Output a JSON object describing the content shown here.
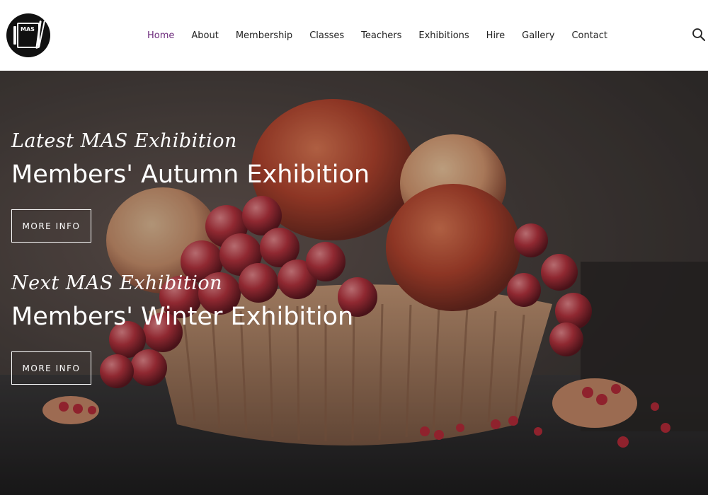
{
  "header": {
    "logo_text": "MAS",
    "nav": [
      {
        "label": "Home",
        "active": true
      },
      {
        "label": "About"
      },
      {
        "label": "Membership"
      },
      {
        "label": "Classes"
      },
      {
        "label": "Teachers"
      },
      {
        "label": "Exhibitions"
      },
      {
        "label": "Hire"
      },
      {
        "label": "Gallery"
      },
      {
        "label": "Contact"
      }
    ],
    "search_icon": "search-icon"
  },
  "hero": {
    "latest": {
      "subtitle": "Latest MAS Exhibition",
      "title": "Members' Autumn Exhibition",
      "button": "MORE INFO"
    },
    "next": {
      "subtitle": "Next MAS Exhibition",
      "title": "Members' Winter Exhibition",
      "button": "MORE INFO"
    }
  },
  "colors": {
    "nav_active": "#6d2b7c",
    "nav_text": "#222222",
    "hero_text": "#ffffff"
  }
}
